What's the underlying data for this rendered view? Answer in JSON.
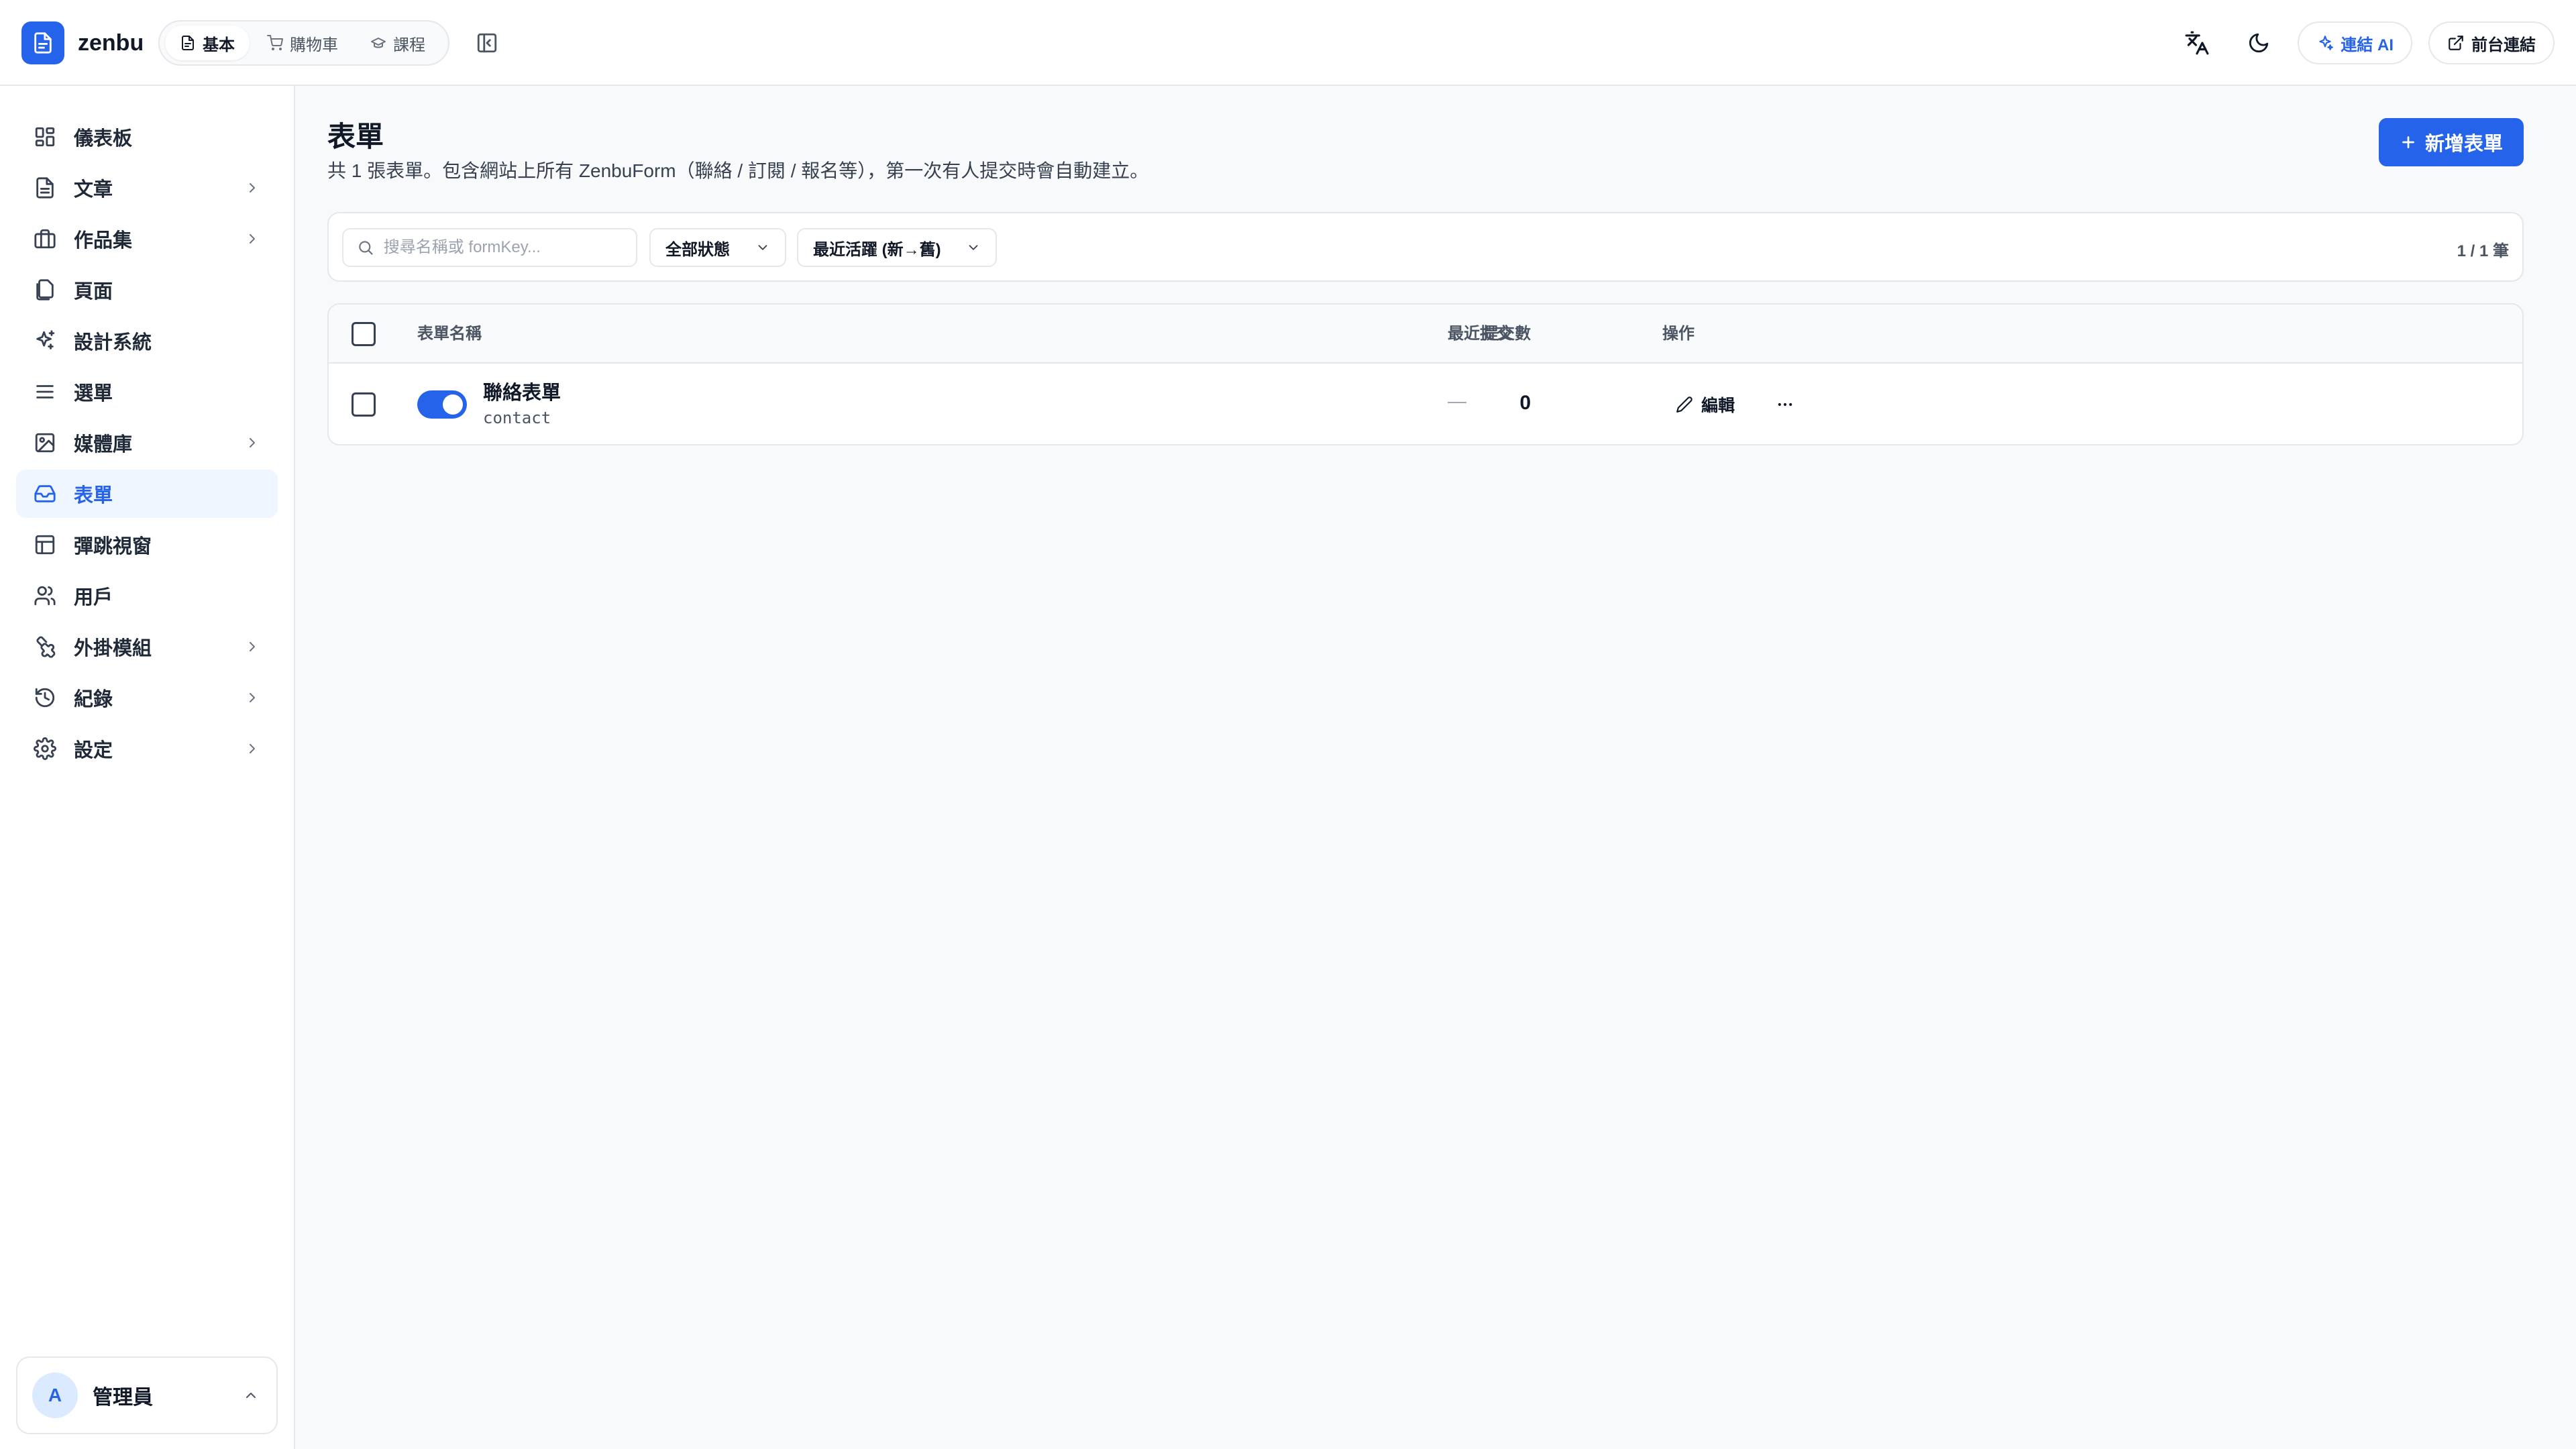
{
  "app": {
    "brand": "zenbu",
    "mode_tabs": [
      {
        "label": "基本",
        "icon": "file-icon",
        "active": true
      },
      {
        "label": "購物車",
        "icon": "cart-icon",
        "active": false
      },
      {
        "label": "課程",
        "icon": "graduation-cap-icon",
        "active": false
      }
    ],
    "connect_ai_label": "連結 AI",
    "frontend_link_label": "前台連結"
  },
  "sidebar": {
    "items": [
      {
        "label": "儀表板",
        "icon": "dashboard-icon",
        "has_children": false,
        "active": false
      },
      {
        "label": "文章",
        "icon": "document-icon",
        "has_children": true,
        "active": false
      },
      {
        "label": "作品集",
        "icon": "briefcase-icon",
        "has_children": true,
        "active": false
      },
      {
        "label": "頁面",
        "icon": "pages-icon",
        "has_children": false,
        "active": false
      },
      {
        "label": "設計系統",
        "icon": "sparkles-icon",
        "has_children": false,
        "active": false
      },
      {
        "label": "選單",
        "icon": "menu-icon",
        "has_children": false,
        "active": false
      },
      {
        "label": "媒體庫",
        "icon": "image-icon",
        "has_children": true,
        "active": false
      },
      {
        "label": "表單",
        "icon": "inbox-icon",
        "has_children": false,
        "active": true
      },
      {
        "label": "彈跳視窗",
        "icon": "layout-icon",
        "has_children": false,
        "active": false
      },
      {
        "label": "用戶",
        "icon": "users-icon",
        "has_children": false,
        "active": false
      },
      {
        "label": "外掛模組",
        "icon": "puzzle-icon",
        "has_children": true,
        "active": false
      },
      {
        "label": "紀錄",
        "icon": "history-icon",
        "has_children": true,
        "active": false
      },
      {
        "label": "設定",
        "icon": "gear-icon",
        "has_children": true,
        "active": false
      }
    ],
    "user": {
      "initial": "A",
      "name": "管理員"
    }
  },
  "main": {
    "title": "表單",
    "subtitle": "共 1 張表單。包含網站上所有 ZenbuForm（聯絡 / 訂閱 / 報名等），第一次有人提交時會自動建立。",
    "new_button_label": "新增表單",
    "filters": {
      "search_placeholder": "搜尋名稱或 formKey...",
      "status_value": "全部狀態",
      "sort_value": "最近活躍 (新→舊)",
      "count_text": "1 / 1 筆"
    },
    "table": {
      "columns": [
        "表單名稱",
        "提交數",
        "最近提交",
        "操作"
      ],
      "rows": [
        {
          "name": "聯絡表單",
          "key": "contact",
          "submissions": "0",
          "last_submitted": "—",
          "enabled": true,
          "edit_label": "編輯"
        }
      ]
    }
  },
  "colors": {
    "accent": "#2563eb",
    "active_bg": "#eff6ff",
    "border": "#e5e7eb"
  }
}
